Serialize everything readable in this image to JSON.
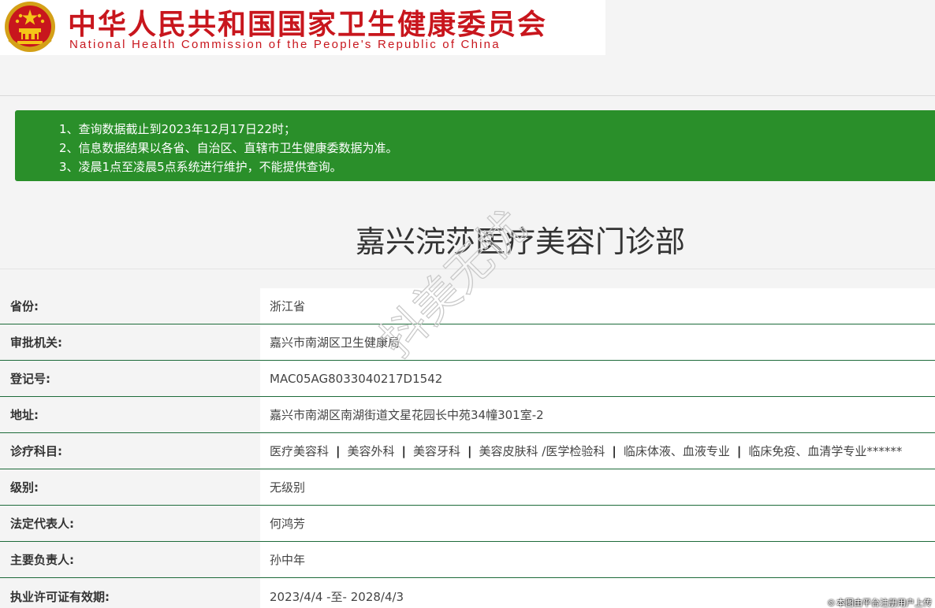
{
  "header": {
    "title_cn": "中华人民共和国国家卫生健康委员会",
    "title_en": "National Health Commission of the People's Republic of China",
    "emblem_icon": "national-emblem-icon"
  },
  "notice": {
    "lines": [
      "1、查询数据截止到2023年12月17日22时；",
      "2、信息数据结果以各省、自治区、直辖市卫生健康委数据为准。",
      "3、凌晨1点至凌晨5点系统进行维护，不能提供查询。"
    ],
    "background": "#2a8f2a"
  },
  "page_title": "嘉兴浣莎医疗美容门诊部",
  "info": {
    "province": {
      "label": "省份:",
      "value": "浙江省"
    },
    "authority": {
      "label": "审批机关:",
      "value": "嘉兴市南湖区卫生健康局"
    },
    "reg_no": {
      "label": "登记号:",
      "value": "MAC05AG8033040217D1542"
    },
    "address": {
      "label": "地址:",
      "value": "嘉兴市南湖区南湖街道文星花园长中苑34幢301室-2"
    },
    "departments": {
      "label": "诊疗科目:",
      "items": [
        "医疗美容科",
        "美容外科",
        "美容牙科",
        "美容皮肤科 /医学检验科",
        "临床体液、血液专业",
        "临床免疫、血清学专业******"
      ],
      "separator": "|"
    },
    "level": {
      "label": "级别:",
      "value": "无级别"
    },
    "legal_rep": {
      "label": "法定代表人:",
      "value": "何鸿芳"
    },
    "principal": {
      "label": "主要负责人:",
      "value": "孙中年"
    },
    "license_validity": {
      "label": "执业许可证有效期:",
      "value": "2023/4/4 -至- 2028/4/3"
    }
  },
  "watermark": {
    "text": "抖美无忧"
  },
  "footnote": {
    "icon": "copyright-icon",
    "symbol": "©",
    "text": "本图由平台注册用户上传"
  },
  "colors": {
    "brand_red": "#c8161d",
    "notice_green": "#2a8f2a",
    "row_rule": "#1d6b3a"
  }
}
